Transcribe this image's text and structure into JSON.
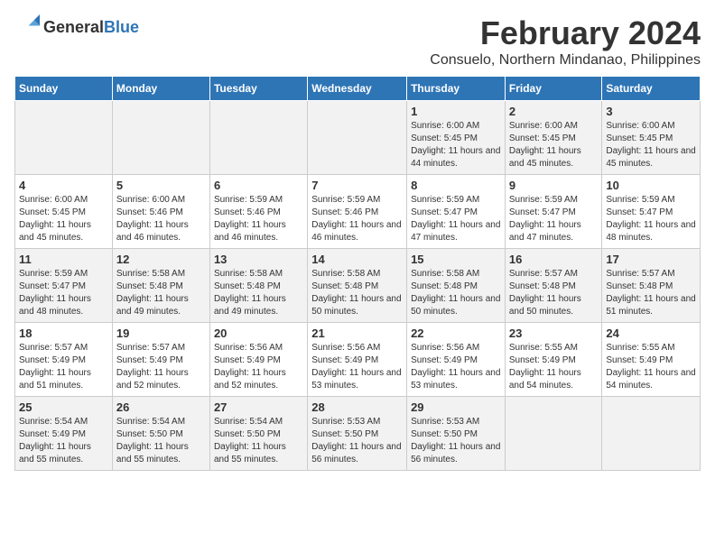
{
  "header": {
    "logo_general": "General",
    "logo_blue": "Blue",
    "month_title": "February 2024",
    "location": "Consuelo, Northern Mindanao, Philippines"
  },
  "days_of_week": [
    "Sunday",
    "Monday",
    "Tuesday",
    "Wednesday",
    "Thursday",
    "Friday",
    "Saturday"
  ],
  "weeks": [
    [
      {
        "day": "",
        "sunrise": "",
        "sunset": "",
        "daylight": ""
      },
      {
        "day": "",
        "sunrise": "",
        "sunset": "",
        "daylight": ""
      },
      {
        "day": "",
        "sunrise": "",
        "sunset": "",
        "daylight": ""
      },
      {
        "day": "",
        "sunrise": "",
        "sunset": "",
        "daylight": ""
      },
      {
        "day": "1",
        "sunrise": "Sunrise: 6:00 AM",
        "sunset": "Sunset: 5:45 PM",
        "daylight": "Daylight: 11 hours and 44 minutes."
      },
      {
        "day": "2",
        "sunrise": "Sunrise: 6:00 AM",
        "sunset": "Sunset: 5:45 PM",
        "daylight": "Daylight: 11 hours and 45 minutes."
      },
      {
        "day": "3",
        "sunrise": "Sunrise: 6:00 AM",
        "sunset": "Sunset: 5:45 PM",
        "daylight": "Daylight: 11 hours and 45 minutes."
      }
    ],
    [
      {
        "day": "4",
        "sunrise": "Sunrise: 6:00 AM",
        "sunset": "Sunset: 5:45 PM",
        "daylight": "Daylight: 11 hours and 45 minutes."
      },
      {
        "day": "5",
        "sunrise": "Sunrise: 6:00 AM",
        "sunset": "Sunset: 5:46 PM",
        "daylight": "Daylight: 11 hours and 46 minutes."
      },
      {
        "day": "6",
        "sunrise": "Sunrise: 5:59 AM",
        "sunset": "Sunset: 5:46 PM",
        "daylight": "Daylight: 11 hours and 46 minutes."
      },
      {
        "day": "7",
        "sunrise": "Sunrise: 5:59 AM",
        "sunset": "Sunset: 5:46 PM",
        "daylight": "Daylight: 11 hours and 46 minutes."
      },
      {
        "day": "8",
        "sunrise": "Sunrise: 5:59 AM",
        "sunset": "Sunset: 5:47 PM",
        "daylight": "Daylight: 11 hours and 47 minutes."
      },
      {
        "day": "9",
        "sunrise": "Sunrise: 5:59 AM",
        "sunset": "Sunset: 5:47 PM",
        "daylight": "Daylight: 11 hours and 47 minutes."
      },
      {
        "day": "10",
        "sunrise": "Sunrise: 5:59 AM",
        "sunset": "Sunset: 5:47 PM",
        "daylight": "Daylight: 11 hours and 48 minutes."
      }
    ],
    [
      {
        "day": "11",
        "sunrise": "Sunrise: 5:59 AM",
        "sunset": "Sunset: 5:47 PM",
        "daylight": "Daylight: 11 hours and 48 minutes."
      },
      {
        "day": "12",
        "sunrise": "Sunrise: 5:58 AM",
        "sunset": "Sunset: 5:48 PM",
        "daylight": "Daylight: 11 hours and 49 minutes."
      },
      {
        "day": "13",
        "sunrise": "Sunrise: 5:58 AM",
        "sunset": "Sunset: 5:48 PM",
        "daylight": "Daylight: 11 hours and 49 minutes."
      },
      {
        "day": "14",
        "sunrise": "Sunrise: 5:58 AM",
        "sunset": "Sunset: 5:48 PM",
        "daylight": "Daylight: 11 hours and 50 minutes."
      },
      {
        "day": "15",
        "sunrise": "Sunrise: 5:58 AM",
        "sunset": "Sunset: 5:48 PM",
        "daylight": "Daylight: 11 hours and 50 minutes."
      },
      {
        "day": "16",
        "sunrise": "Sunrise: 5:57 AM",
        "sunset": "Sunset: 5:48 PM",
        "daylight": "Daylight: 11 hours and 50 minutes."
      },
      {
        "day": "17",
        "sunrise": "Sunrise: 5:57 AM",
        "sunset": "Sunset: 5:48 PM",
        "daylight": "Daylight: 11 hours and 51 minutes."
      }
    ],
    [
      {
        "day": "18",
        "sunrise": "Sunrise: 5:57 AM",
        "sunset": "Sunset: 5:49 PM",
        "daylight": "Daylight: 11 hours and 51 minutes."
      },
      {
        "day": "19",
        "sunrise": "Sunrise: 5:57 AM",
        "sunset": "Sunset: 5:49 PM",
        "daylight": "Daylight: 11 hours and 52 minutes."
      },
      {
        "day": "20",
        "sunrise": "Sunrise: 5:56 AM",
        "sunset": "Sunset: 5:49 PM",
        "daylight": "Daylight: 11 hours and 52 minutes."
      },
      {
        "day": "21",
        "sunrise": "Sunrise: 5:56 AM",
        "sunset": "Sunset: 5:49 PM",
        "daylight": "Daylight: 11 hours and 53 minutes."
      },
      {
        "day": "22",
        "sunrise": "Sunrise: 5:56 AM",
        "sunset": "Sunset: 5:49 PM",
        "daylight": "Daylight: 11 hours and 53 minutes."
      },
      {
        "day": "23",
        "sunrise": "Sunrise: 5:55 AM",
        "sunset": "Sunset: 5:49 PM",
        "daylight": "Daylight: 11 hours and 54 minutes."
      },
      {
        "day": "24",
        "sunrise": "Sunrise: 5:55 AM",
        "sunset": "Sunset: 5:49 PM",
        "daylight": "Daylight: 11 hours and 54 minutes."
      }
    ],
    [
      {
        "day": "25",
        "sunrise": "Sunrise: 5:54 AM",
        "sunset": "Sunset: 5:49 PM",
        "daylight": "Daylight: 11 hours and 55 minutes."
      },
      {
        "day": "26",
        "sunrise": "Sunrise: 5:54 AM",
        "sunset": "Sunset: 5:50 PM",
        "daylight": "Daylight: 11 hours and 55 minutes."
      },
      {
        "day": "27",
        "sunrise": "Sunrise: 5:54 AM",
        "sunset": "Sunset: 5:50 PM",
        "daylight": "Daylight: 11 hours and 55 minutes."
      },
      {
        "day": "28",
        "sunrise": "Sunrise: 5:53 AM",
        "sunset": "Sunset: 5:50 PM",
        "daylight": "Daylight: 11 hours and 56 minutes."
      },
      {
        "day": "29",
        "sunrise": "Sunrise: 5:53 AM",
        "sunset": "Sunset: 5:50 PM",
        "daylight": "Daylight: 11 hours and 56 minutes."
      },
      {
        "day": "",
        "sunrise": "",
        "sunset": "",
        "daylight": ""
      },
      {
        "day": "",
        "sunrise": "",
        "sunset": "",
        "daylight": ""
      }
    ]
  ]
}
